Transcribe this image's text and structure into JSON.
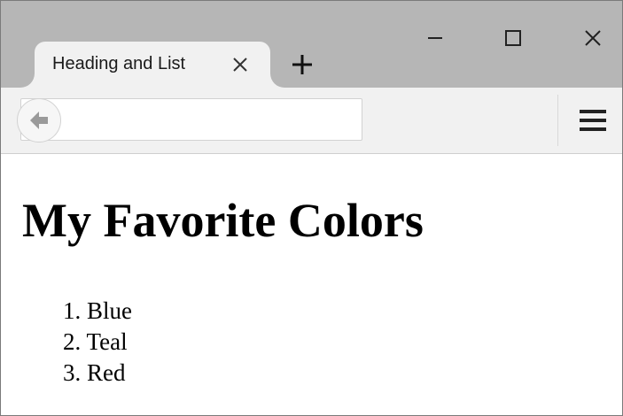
{
  "browser": {
    "tab": {
      "title": "Heading and List",
      "close_icon": "close-icon"
    },
    "new_tab_icon": "plus-icon",
    "window_controls": [
      "minimize-icon",
      "maximize-icon",
      "close-icon"
    ],
    "address_bar": {
      "value": "",
      "placeholder": ""
    },
    "back_icon": "arrow-left-icon",
    "menu_icon": "hamburger-menu-icon"
  },
  "page": {
    "heading": "My Favorite Colors",
    "list": [
      {
        "number": "1.",
        "text": "Blue"
      },
      {
        "number": "2.",
        "text": "Teal"
      },
      {
        "number": "3.",
        "text": "Red"
      }
    ]
  },
  "colors": {
    "tabstrip": "#b6b6b6",
    "toolbar": "#f1f1f1",
    "page_background": "#ffffff"
  }
}
